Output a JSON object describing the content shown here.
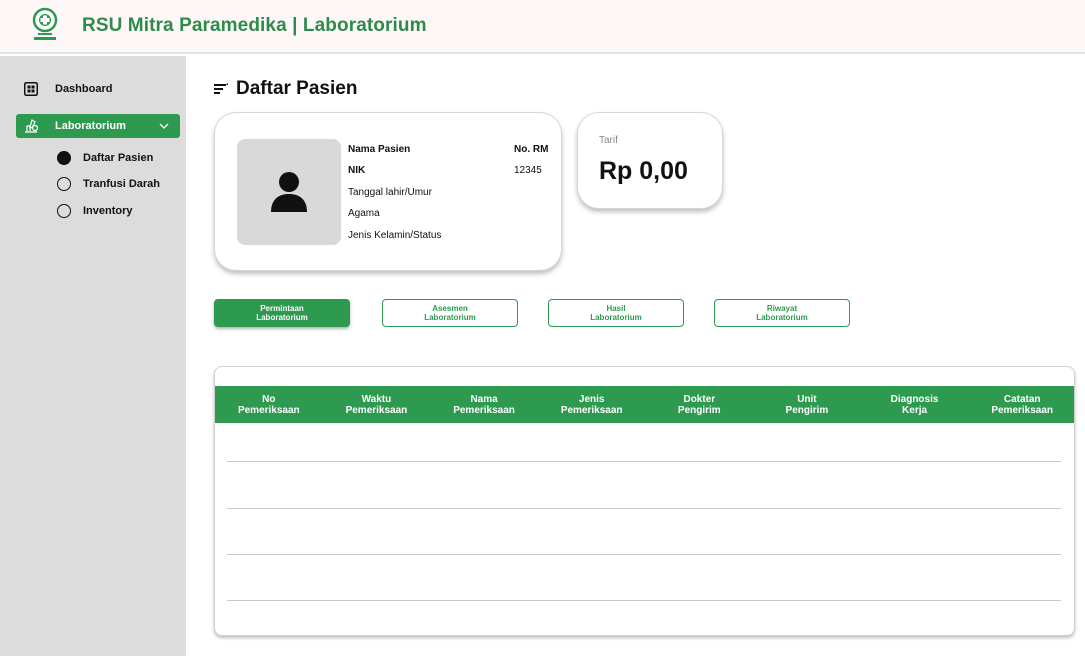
{
  "header": {
    "title": "RSU Mitra Paramedika | Laboratorium",
    "logo_icon": "hospital-logo-icon",
    "accent_color": "#2e9a4f"
  },
  "sidebar": {
    "dashboard": {
      "label": "Dashboard",
      "icon": "dashboard-grid-icon"
    },
    "laboratorium": {
      "label": "Laboratorium",
      "icon": "lab-microscope-icon",
      "expanded": true
    },
    "sub_items": [
      {
        "label": "Daftar Pasien",
        "selected": true
      },
      {
        "label": "Tranfusi Darah",
        "selected": false
      },
      {
        "label": "Inventory",
        "selected": false
      }
    ]
  },
  "main": {
    "page_title": "Daftar Pasien",
    "patient": {
      "nama_label": "Nama Pasien",
      "nik_label": "NIK",
      "ttl_label": "Tanggal lahir/Umur",
      "agama_label": "Agama",
      "jk_label": "Jenis Kelamin/Status",
      "rm_label": "No. RM",
      "rm_value": "12345"
    },
    "tarif": {
      "label": "Tarif",
      "value": "Rp 0,00"
    },
    "tabs": [
      {
        "line1": "Permintaan",
        "line2": "Laboratorium",
        "active": true
      },
      {
        "line1": "Asesmen",
        "line2": "Laboratorium",
        "active": false
      },
      {
        "line1": "Hasil",
        "line2": "Laboratorium",
        "active": false
      },
      {
        "line1": "Riwayat",
        "line2": "Laboratorium",
        "active": false
      }
    ],
    "table": {
      "columns": [
        {
          "line1": "No",
          "line2": "Pemeriksaan"
        },
        {
          "line1": "Waktu",
          "line2": "Pemeriksaan"
        },
        {
          "line1": "Nama",
          "line2": "Pemeriksaan"
        },
        {
          "line1": "Jenis",
          "line2": "Pemeriksaan"
        },
        {
          "line1": "Dokter",
          "line2": "Pengirim"
        },
        {
          "line1": "Unit",
          "line2": "Pengirim"
        },
        {
          "line1": "Diagnosis",
          "line2": "Kerja"
        },
        {
          "line1": "Catatan",
          "line2": "Pemeriksaan"
        }
      ],
      "rows": []
    }
  }
}
